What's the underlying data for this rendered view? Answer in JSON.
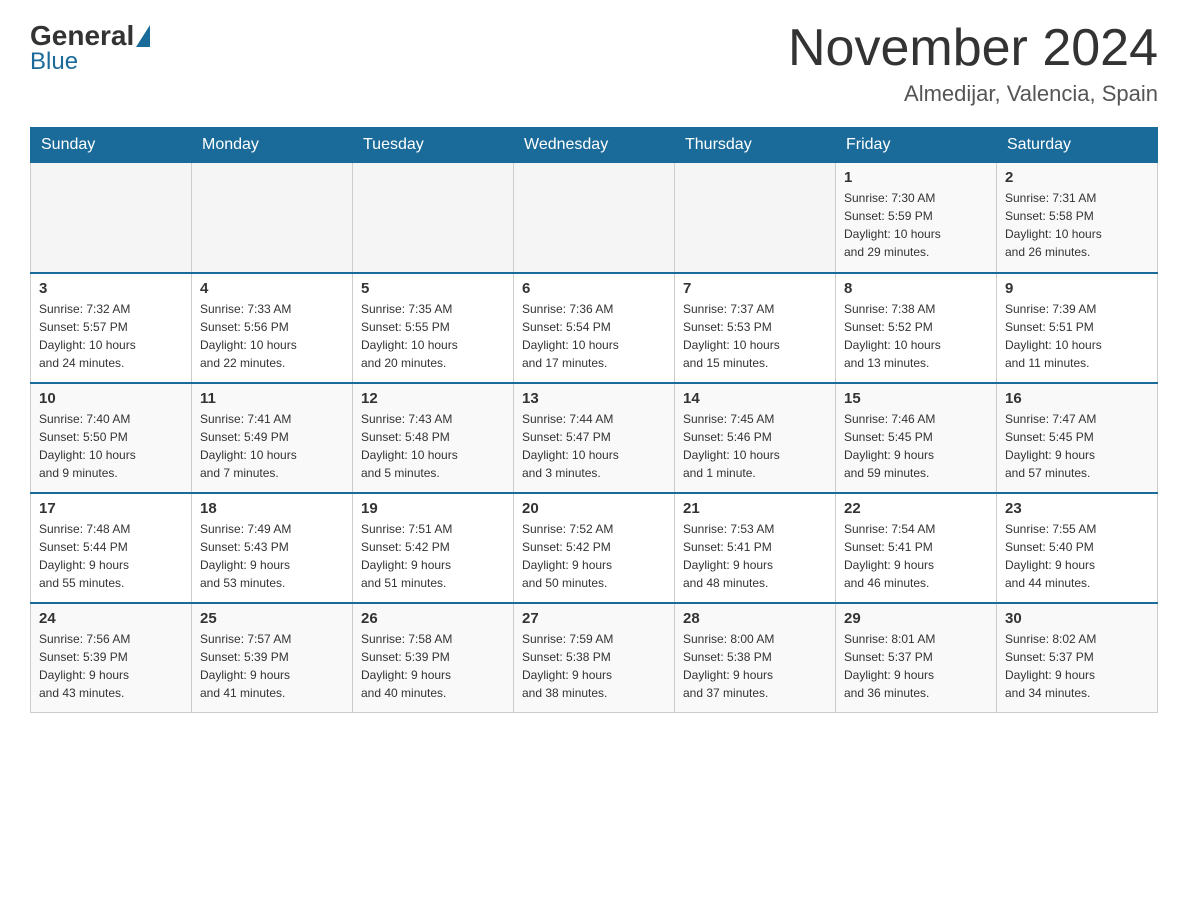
{
  "header": {
    "logo": {
      "general": "General",
      "blue": "Blue"
    },
    "title": "November 2024",
    "location": "Almedijar, Valencia, Spain"
  },
  "days_of_week": [
    "Sunday",
    "Monday",
    "Tuesday",
    "Wednesday",
    "Thursday",
    "Friday",
    "Saturday"
  ],
  "weeks": [
    [
      {
        "day": "",
        "info": ""
      },
      {
        "day": "",
        "info": ""
      },
      {
        "day": "",
        "info": ""
      },
      {
        "day": "",
        "info": ""
      },
      {
        "day": "",
        "info": ""
      },
      {
        "day": "1",
        "info": "Sunrise: 7:30 AM\nSunset: 5:59 PM\nDaylight: 10 hours\nand 29 minutes."
      },
      {
        "day": "2",
        "info": "Sunrise: 7:31 AM\nSunset: 5:58 PM\nDaylight: 10 hours\nand 26 minutes."
      }
    ],
    [
      {
        "day": "3",
        "info": "Sunrise: 7:32 AM\nSunset: 5:57 PM\nDaylight: 10 hours\nand 24 minutes."
      },
      {
        "day": "4",
        "info": "Sunrise: 7:33 AM\nSunset: 5:56 PM\nDaylight: 10 hours\nand 22 minutes."
      },
      {
        "day": "5",
        "info": "Sunrise: 7:35 AM\nSunset: 5:55 PM\nDaylight: 10 hours\nand 20 minutes."
      },
      {
        "day": "6",
        "info": "Sunrise: 7:36 AM\nSunset: 5:54 PM\nDaylight: 10 hours\nand 17 minutes."
      },
      {
        "day": "7",
        "info": "Sunrise: 7:37 AM\nSunset: 5:53 PM\nDaylight: 10 hours\nand 15 minutes."
      },
      {
        "day": "8",
        "info": "Sunrise: 7:38 AM\nSunset: 5:52 PM\nDaylight: 10 hours\nand 13 minutes."
      },
      {
        "day": "9",
        "info": "Sunrise: 7:39 AM\nSunset: 5:51 PM\nDaylight: 10 hours\nand 11 minutes."
      }
    ],
    [
      {
        "day": "10",
        "info": "Sunrise: 7:40 AM\nSunset: 5:50 PM\nDaylight: 10 hours\nand 9 minutes."
      },
      {
        "day": "11",
        "info": "Sunrise: 7:41 AM\nSunset: 5:49 PM\nDaylight: 10 hours\nand 7 minutes."
      },
      {
        "day": "12",
        "info": "Sunrise: 7:43 AM\nSunset: 5:48 PM\nDaylight: 10 hours\nand 5 minutes."
      },
      {
        "day": "13",
        "info": "Sunrise: 7:44 AM\nSunset: 5:47 PM\nDaylight: 10 hours\nand 3 minutes."
      },
      {
        "day": "14",
        "info": "Sunrise: 7:45 AM\nSunset: 5:46 PM\nDaylight: 10 hours\nand 1 minute."
      },
      {
        "day": "15",
        "info": "Sunrise: 7:46 AM\nSunset: 5:45 PM\nDaylight: 9 hours\nand 59 minutes."
      },
      {
        "day": "16",
        "info": "Sunrise: 7:47 AM\nSunset: 5:45 PM\nDaylight: 9 hours\nand 57 minutes."
      }
    ],
    [
      {
        "day": "17",
        "info": "Sunrise: 7:48 AM\nSunset: 5:44 PM\nDaylight: 9 hours\nand 55 minutes."
      },
      {
        "day": "18",
        "info": "Sunrise: 7:49 AM\nSunset: 5:43 PM\nDaylight: 9 hours\nand 53 minutes."
      },
      {
        "day": "19",
        "info": "Sunrise: 7:51 AM\nSunset: 5:42 PM\nDaylight: 9 hours\nand 51 minutes."
      },
      {
        "day": "20",
        "info": "Sunrise: 7:52 AM\nSunset: 5:42 PM\nDaylight: 9 hours\nand 50 minutes."
      },
      {
        "day": "21",
        "info": "Sunrise: 7:53 AM\nSunset: 5:41 PM\nDaylight: 9 hours\nand 48 minutes."
      },
      {
        "day": "22",
        "info": "Sunrise: 7:54 AM\nSunset: 5:41 PM\nDaylight: 9 hours\nand 46 minutes."
      },
      {
        "day": "23",
        "info": "Sunrise: 7:55 AM\nSunset: 5:40 PM\nDaylight: 9 hours\nand 44 minutes."
      }
    ],
    [
      {
        "day": "24",
        "info": "Sunrise: 7:56 AM\nSunset: 5:39 PM\nDaylight: 9 hours\nand 43 minutes."
      },
      {
        "day": "25",
        "info": "Sunrise: 7:57 AM\nSunset: 5:39 PM\nDaylight: 9 hours\nand 41 minutes."
      },
      {
        "day": "26",
        "info": "Sunrise: 7:58 AM\nSunset: 5:39 PM\nDaylight: 9 hours\nand 40 minutes."
      },
      {
        "day": "27",
        "info": "Sunrise: 7:59 AM\nSunset: 5:38 PM\nDaylight: 9 hours\nand 38 minutes."
      },
      {
        "day": "28",
        "info": "Sunrise: 8:00 AM\nSunset: 5:38 PM\nDaylight: 9 hours\nand 37 minutes."
      },
      {
        "day": "29",
        "info": "Sunrise: 8:01 AM\nSunset: 5:37 PM\nDaylight: 9 hours\nand 36 minutes."
      },
      {
        "day": "30",
        "info": "Sunrise: 8:02 AM\nSunset: 5:37 PM\nDaylight: 9 hours\nand 34 minutes."
      }
    ]
  ]
}
